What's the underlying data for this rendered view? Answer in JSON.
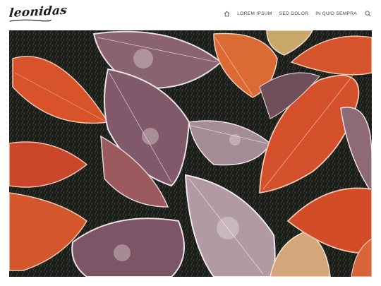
{
  "header": {
    "logo_text": "leonidas",
    "nav": [
      {
        "icon": "home-icon"
      },
      {
        "label": "LOREM IPSUM"
      },
      {
        "label": "SED DOLOR"
      },
      {
        "label": "IN QUID SEMPRA"
      },
      {
        "icon": "search-icon"
      }
    ]
  },
  "hero": {
    "image_subject": "frosted autumn leaves on grass",
    "colors": {
      "orange_leaf": "#d9532a",
      "rust_leaf": "#b8401e",
      "mauve_leaf": "#8a6370",
      "lavender_leaf": "#a48892",
      "frost": "#e8dfe4",
      "background": "#1b1d18"
    }
  }
}
